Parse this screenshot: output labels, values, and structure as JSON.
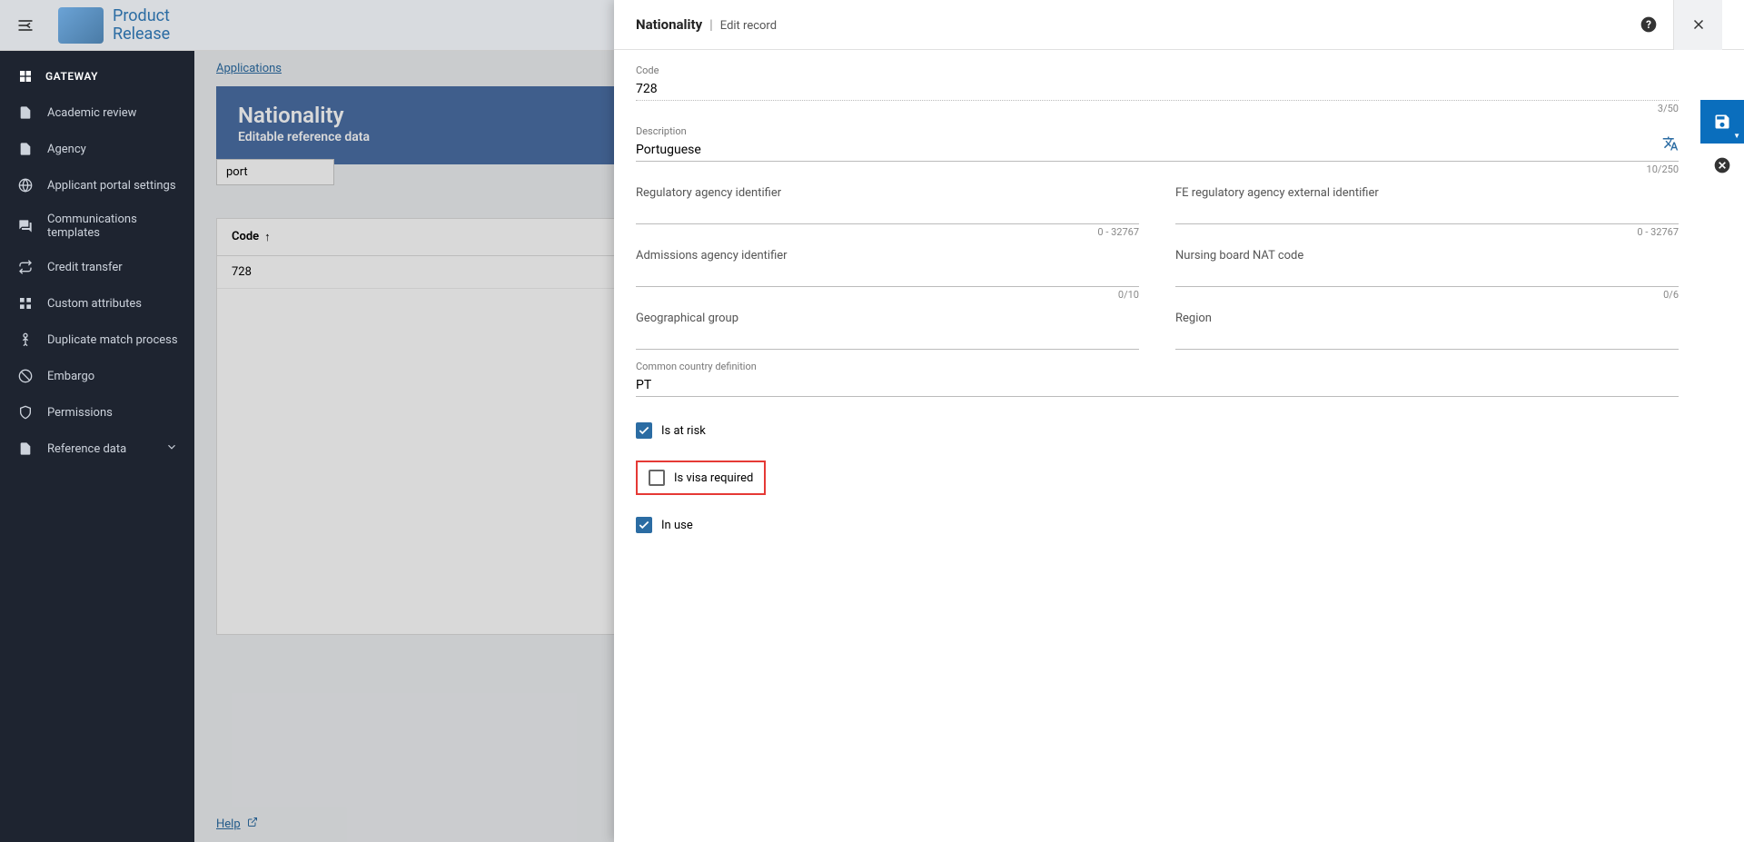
{
  "header": {
    "product_line1": "Product",
    "product_line2": "Release"
  },
  "sidebar": {
    "heading": "GATEWAY",
    "items": [
      {
        "label": "Academic review",
        "icon": "document-icon"
      },
      {
        "label": "Agency",
        "icon": "document-icon"
      },
      {
        "label": "Applicant portal settings",
        "icon": "globe-icon"
      },
      {
        "label": "Communications templates",
        "icon": "chat-icon"
      },
      {
        "label": "Credit transfer",
        "icon": "arrows-icon"
      },
      {
        "label": "Custom attributes",
        "icon": "grid-icon"
      },
      {
        "label": "Duplicate match process",
        "icon": "person-icon"
      },
      {
        "label": "Embargo",
        "icon": "block-icon"
      },
      {
        "label": "Permissions",
        "icon": "shield-icon"
      },
      {
        "label": "Reference data",
        "icon": "document-icon",
        "expandable": true
      }
    ]
  },
  "background_page": {
    "breadcrumb_link": "Applications",
    "title": "Nationality",
    "subtitle": "Editable reference data",
    "search_value": "port",
    "table_header_code": "Code",
    "table_row_code": "728",
    "help_label": "Help"
  },
  "modal": {
    "title": "Nationality",
    "subtitle": "Edit record",
    "fields": {
      "code_label": "Code",
      "code_value": "728",
      "code_hint": "3/50",
      "description_label": "Description",
      "description_value": "Portuguese",
      "description_hint": "10/250",
      "reg_agency_label": "Regulatory agency identifier",
      "reg_agency_hint": "0 - 32767",
      "fe_reg_agency_label": "FE regulatory agency external identifier",
      "fe_reg_agency_hint": "0 - 32767",
      "admissions_label": "Admissions agency identifier",
      "admissions_hint": "0/10",
      "nursing_label": "Nursing board NAT code",
      "nursing_hint": "0/6",
      "geo_group_label": "Geographical group",
      "region_label": "Region",
      "country_def_label": "Common country definition",
      "country_def_value": "PT",
      "is_at_risk_label": "Is at risk",
      "is_visa_required_label": "Is visa required",
      "in_use_label": "In use"
    }
  }
}
